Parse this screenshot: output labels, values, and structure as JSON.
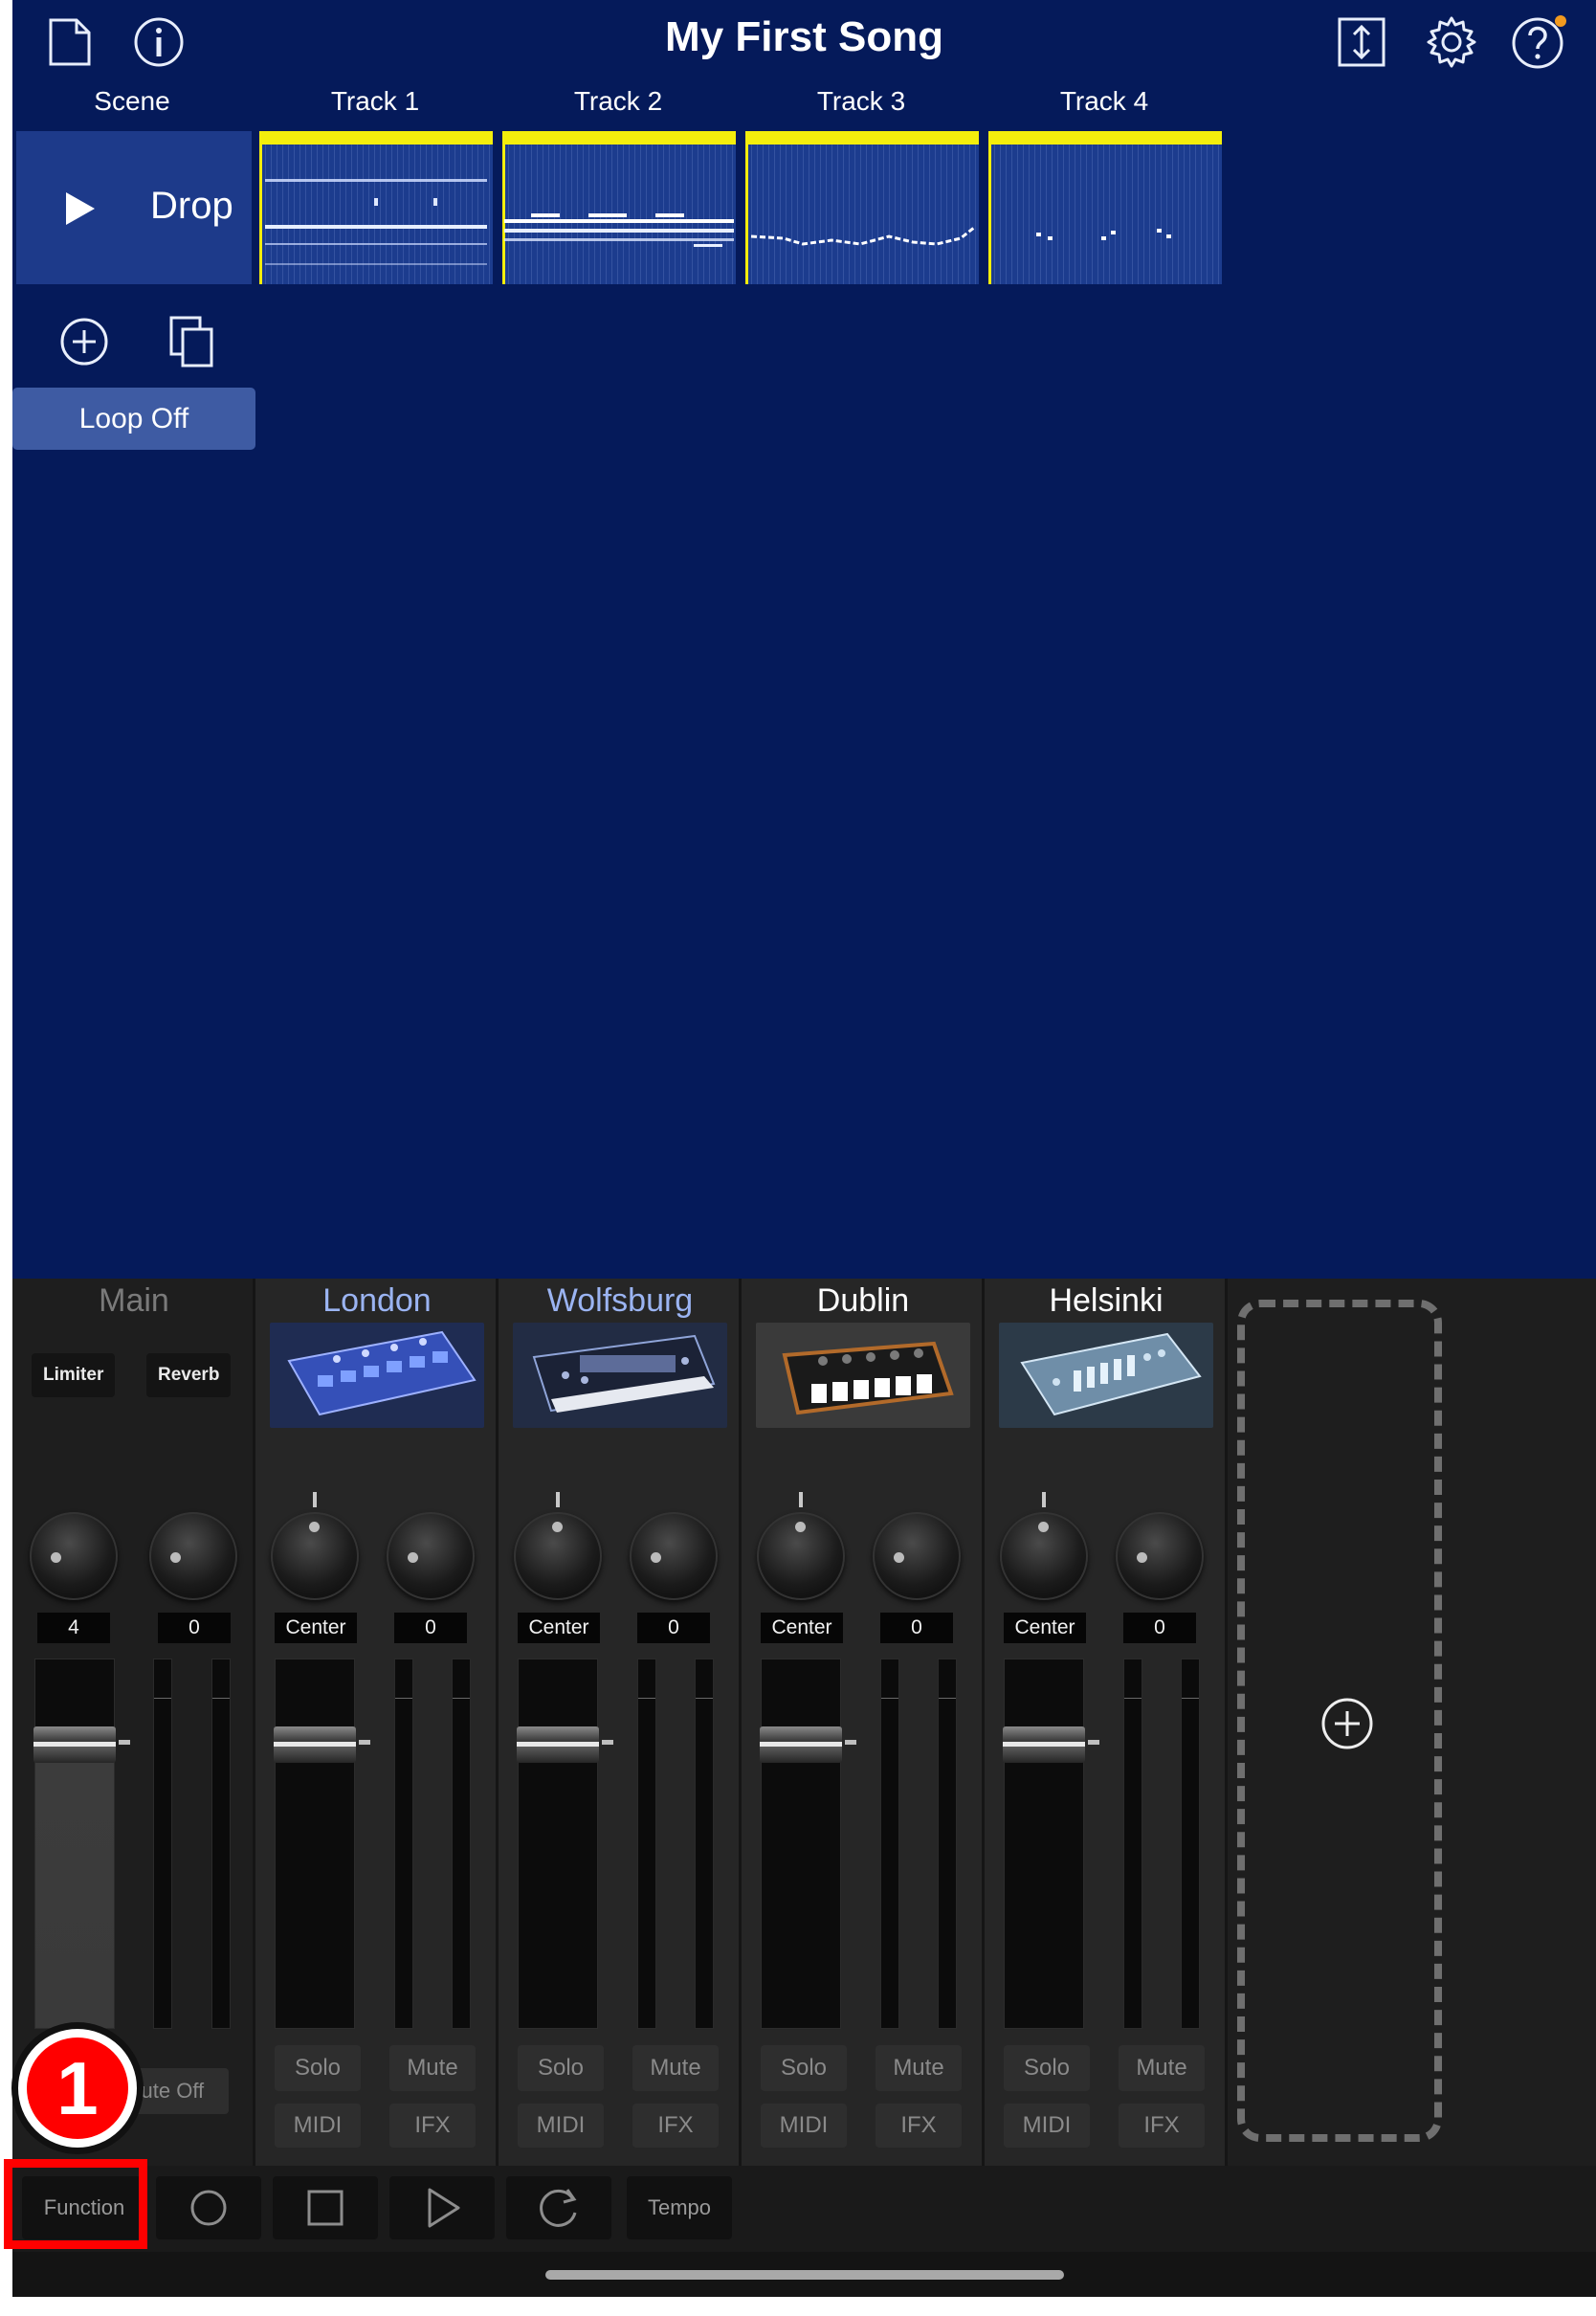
{
  "header": {
    "song_title": "My First Song",
    "icons": {
      "new_document": "document-icon",
      "info": "info-icon",
      "export": "updown-arrow-icon",
      "settings": "gear-icon",
      "help": "help-icon",
      "notification_dot_color": "#f29a1f"
    }
  },
  "grid": {
    "scene_column_label": "Scene",
    "track_labels": [
      "Track 1",
      "Track 2",
      "Track 3",
      "Track 4"
    ],
    "scene": {
      "name": "Drop"
    },
    "clip_marker_color": "#f4ee0c",
    "loop_button_label": "Loop Off",
    "icons": {
      "add_scene": "plus-circle-icon",
      "duplicate_scene": "duplicate-icon"
    }
  },
  "mixer": {
    "main": {
      "name": "Main",
      "effects": [
        "Limiter",
        "Reverb"
      ],
      "knob_values": [
        "4",
        "0"
      ],
      "button_partial": "o/Mute Off"
    },
    "channels": [
      {
        "name": "London",
        "color": "#9bb4f2",
        "pan": "Center",
        "send": "0",
        "solo": "Solo",
        "mute": "Mute",
        "midi": "MIDI",
        "ifx": "IFX"
      },
      {
        "name": "Wolfsburg",
        "color": "#9bb4f2",
        "pan": "Center",
        "send": "0",
        "solo": "Solo",
        "mute": "Mute",
        "midi": "MIDI",
        "ifx": "IFX"
      },
      {
        "name": "Dublin",
        "color": "#ffffff",
        "pan": "Center",
        "send": "0",
        "solo": "Solo",
        "mute": "Mute",
        "midi": "MIDI",
        "ifx": "IFX"
      },
      {
        "name": "Helsinki",
        "color": "#ffffff",
        "pan": "Center",
        "send": "0",
        "solo": "Solo",
        "mute": "Mute",
        "midi": "MIDI",
        "ifx": "IFX"
      }
    ],
    "add_track_icon": "plus-circle-icon"
  },
  "transport": {
    "function_label": "Function",
    "tempo_label": "Tempo",
    "icons": {
      "record": "record-circle-icon",
      "stop": "stop-square-icon",
      "play": "play-triangle-icon",
      "loop": "loop-arrow-icon"
    }
  },
  "annotation": {
    "step_number": "1",
    "highlight_color": "#ff0000"
  }
}
